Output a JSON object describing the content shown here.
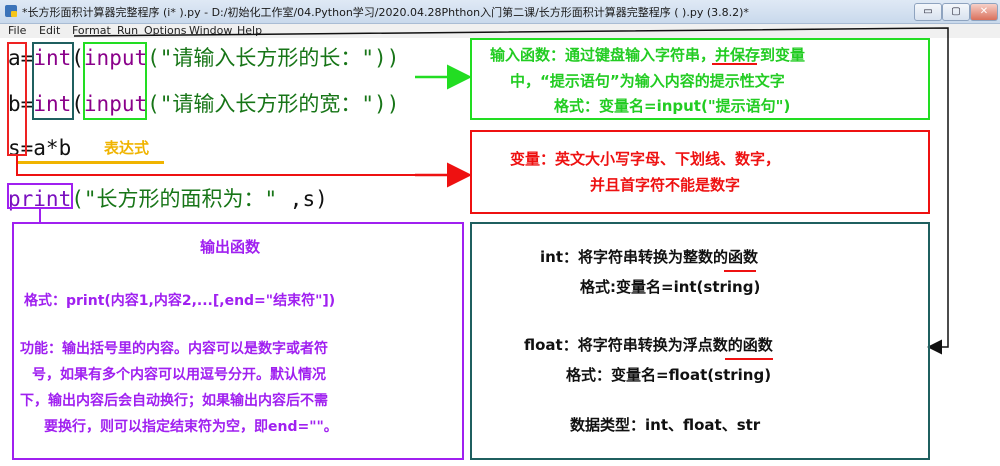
{
  "window": {
    "title": "*长方形面积计算器完整程序 (i*                    ).py - D:/初始化工作室/04.Python学习/2020.04.28Phthon入门第二课/长方形面积计算器完整程序 (           ).py (3.8.2)*",
    "buttons": [
      "▭",
      "▢",
      "✕"
    ]
  },
  "menu": [
    "File",
    "Edit",
    "Format",
    "Run",
    "Options",
    "Window",
    "Help"
  ],
  "code": {
    "line1": {
      "var": "a",
      "eq": "=",
      "int": "int",
      "open": "(",
      "input": "input",
      "str": "(\"请输入长方形的长：\"))"
    },
    "line2": {
      "var": "b",
      "eq": "=",
      "int": "int",
      "open": "(",
      "input": "input",
      "str": "(\"请输入长方形的宽：\"))"
    },
    "line3": {
      "text": "s=a*b"
    },
    "line4": {
      "print": "print",
      "str": "(\"长方形的面积为：\"",
      "rest": " ,s)"
    }
  },
  "notes": {
    "expression": "表达式",
    "input_box": {
      "line1": "输入函数：通过键盘输入字符串，并保存到变量",
      "line2": "中，“提示语句”为输入内容的提示性文字",
      "line3": "格式：变量名=input(\"提示语句\")"
    },
    "var_box": {
      "line1": "变量：英文大小写字母、下划线、数字，",
      "line2": "并且首字符不能是数字"
    },
    "print_box": {
      "title": "输出函数",
      "format": "格式：print(内容1,内容2,...[,end=\"结束符\"])",
      "f1": "功能：输出括号里的内容。内容可以是数字或者符",
      "f2": "号，如果有多个内容可以用逗号分开。默认情况",
      "f3": "下，输出内容后会自动换行；如果输出内容后不需",
      "f4": "要换行，则可以指定结束符为空，即end=\"\"。"
    },
    "type_box": {
      "int1": "int：将字符串转换为整数的函数",
      "int2": "格式:变量名=int(string)",
      "float1": "float：将字符串转换为浮点数的函数",
      "float2": "格式：变量名=float(string)",
      "types": "数据类型：int、float、str"
    }
  },
  "colors": {
    "green": "#22dd22",
    "red": "#ee1111",
    "purple": "#a020f0",
    "teal": "#1f5f5f",
    "gold": "#f0b400"
  }
}
